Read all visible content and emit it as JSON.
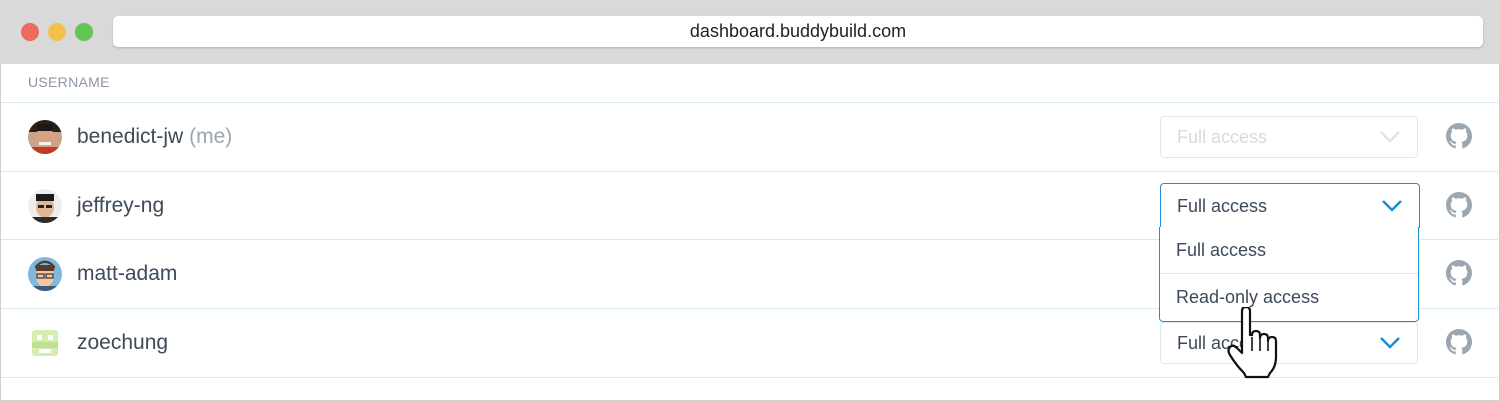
{
  "browser": {
    "url": "dashboard.buddybuild.com"
  },
  "table": {
    "column_header": "USERNAME",
    "rows": [
      {
        "username": "benedict-jw",
        "me_tag": "(me)",
        "access": "Full access",
        "disabled": true,
        "avatar": "photo-avatar"
      },
      {
        "username": "jeffrey-ng",
        "access": "Full access",
        "open": true,
        "avatar": "photo-avatar"
      },
      {
        "username": "matt-adam",
        "access": "",
        "avatar": "illustrated-avatar"
      },
      {
        "username": "zoechung",
        "access": "Full access",
        "avatar": "pixel-avatar"
      }
    ]
  },
  "dropdown": {
    "options": [
      "Full access",
      "Read-only access"
    ]
  },
  "colors": {
    "accent": "#1a8fd8",
    "text": "#3c4a5a",
    "muted": "#8b97a3",
    "row_border": "#d6e8f2"
  },
  "icons": {
    "row_action": "github-icon",
    "select_indicator": "chevron-down-icon",
    "pointer": "hand-pointer-cursor"
  }
}
